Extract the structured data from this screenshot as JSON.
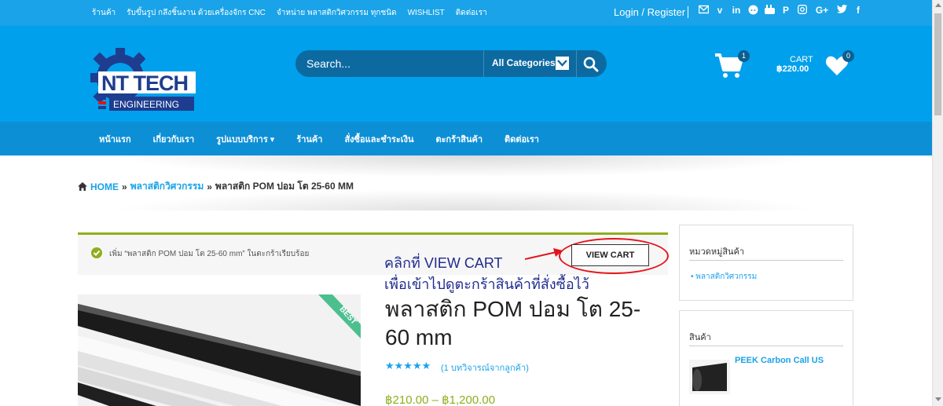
{
  "topbar": {
    "links": [
      "ร้านค้า",
      "รับขึ้นรูป กลึงชิ้นงาน ด้วยเครื่องจักร CNC",
      "จำหน่าย พลาสติกวิศวกรรม ทุกชนิด",
      "WISHLIST",
      "ติดต่อเรา"
    ],
    "login": "Login / Register",
    "social_icons": [
      "mail-icon",
      "vimeo-icon",
      "linkedin-icon",
      "reddit-icon",
      "youtube-icon",
      "pinterest-icon",
      "instagram-icon",
      "google-plus-icon",
      "twitter-icon",
      "facebook-icon"
    ]
  },
  "header": {
    "logo_text_1": "NT TECH",
    "logo_text_2": "ENGINEERING",
    "search_placeholder": "Search...",
    "category": "All Categories",
    "cart_count": "1",
    "cart_label": "CART",
    "cart_total": "฿220.00",
    "wishlist_count": "0"
  },
  "nav": {
    "items": [
      "หน้าแรก",
      "เกี่ยวกับเรา",
      "รูปแบบบริการ ▾",
      "ร้านค้า",
      "สั่งซื้อและชำระเงิน",
      "ตะกร้าสินค้า",
      "ติดต่อเรา"
    ]
  },
  "breadcrumb": {
    "home": "HOME",
    "sep": "»",
    "category": "พลาสติกวิศวกรรม",
    "current": "พลาสติก POM ปอม โต 25-60 MM"
  },
  "notice": {
    "text": "เพิ่ม “พลาสติก POM ปอม โต 25-60 mm” ในตะกร้าเรียบร้อย",
    "button": "VIEW CART"
  },
  "annotation": {
    "line1": "คลิกที่ VIEW CART",
    "line2": "เพื่อเข้าไปดูตะกร้าสินค้าที่สั่งซื้อไว้"
  },
  "product": {
    "badge": "BEST",
    "title": "พลาสติก POM ปอม โต 25-60 mm",
    "rating": 5,
    "stars": "★★★★★",
    "reviews": "(1 บทวิจารณ์จากลูกค้า)",
    "price": "฿210.00 – ฿1,200.00"
  },
  "sidebar": {
    "widget1_title": "หมวดหมู่สินค้า",
    "widget1_item": "• พลาสติกวิศวกรรม",
    "widget2_title": "สินค้า",
    "widget2_product": "PEEK Carbon Call US"
  },
  "colors": {
    "topbar": "#1aa3e8",
    "header": "#00a0ec",
    "nav": "#0d8fd6",
    "accent_green": "#8fae1b",
    "annotation_red": "#e3141a"
  }
}
